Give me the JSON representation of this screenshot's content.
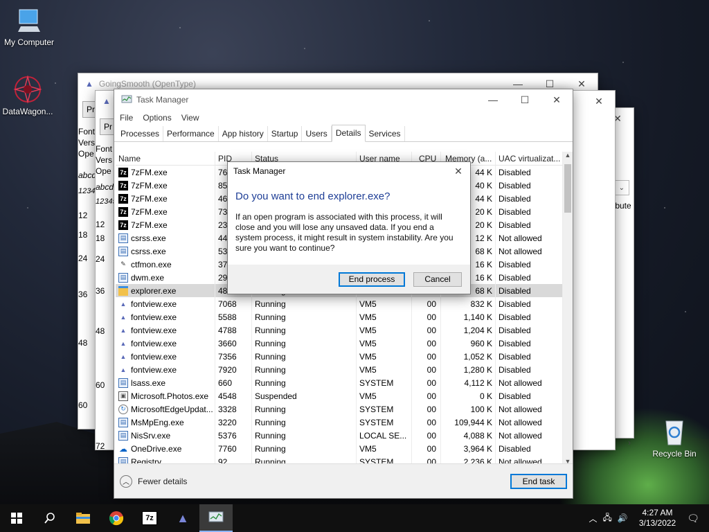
{
  "desktop": {
    "icons": [
      {
        "label": "My Computer"
      },
      {
        "label": "DataWagon..."
      },
      {
        "label": "Recycle Bin"
      }
    ]
  },
  "bg_window_1": {
    "title": "GoingSmooth (OpenType)",
    "left_labels": [
      "Pr",
      "Font",
      "Vers",
      "Ope",
      "abcd",
      "12345",
      "12",
      "18",
      "24",
      "36",
      "48",
      "60"
    ]
  },
  "bg_window_2": {
    "left_labels": [
      "Pr",
      "Font",
      "Vers",
      "Ope",
      "abcd",
      "12345",
      "12",
      "18",
      "24",
      "36",
      "48",
      "60",
      "72"
    ]
  },
  "bg_window_3": {
    "attribute_label": "Attribute"
  },
  "task_manager": {
    "title": "Task Manager",
    "menu": [
      "File",
      "Options",
      "View"
    ],
    "tabs": [
      "Processes",
      "Performance",
      "App history",
      "Startup",
      "Users",
      "Details",
      "Services"
    ],
    "active_tab": "Details",
    "columns": [
      "Name",
      "PID",
      "Status",
      "User name",
      "CPU",
      "Memory (a...",
      "UAC virtualizat..."
    ],
    "rows": [
      {
        "name": "7zFM.exe",
        "pid": "76",
        "status": "",
        "user": "",
        "cpu": "",
        "mem": "44 K",
        "uac": "Disabled",
        "icon": "7z"
      },
      {
        "name": "7zFM.exe",
        "pid": "85",
        "status": "",
        "user": "",
        "cpu": "",
        "mem": "40 K",
        "uac": "Disabled",
        "icon": "7z"
      },
      {
        "name": "7zFM.exe",
        "pid": "46",
        "status": "",
        "user": "",
        "cpu": "",
        "mem": "44 K",
        "uac": "Disabled",
        "icon": "7z"
      },
      {
        "name": "7zFM.exe",
        "pid": "73",
        "status": "",
        "user": "",
        "cpu": "",
        "mem": "20 K",
        "uac": "Disabled",
        "icon": "7z"
      },
      {
        "name": "7zFM.exe",
        "pid": "23",
        "status": "",
        "user": "",
        "cpu": "",
        "mem": "20 K",
        "uac": "Disabled",
        "icon": "7z"
      },
      {
        "name": "csrss.exe",
        "pid": "44",
        "status": "",
        "user": "",
        "cpu": "",
        "mem": "12 K",
        "uac": "Not allowed",
        "icon": "sys"
      },
      {
        "name": "csrss.exe",
        "pid": "53",
        "status": "",
        "user": "",
        "cpu": "",
        "mem": "68 K",
        "uac": "Not allowed",
        "icon": "sys"
      },
      {
        "name": "ctfmon.exe",
        "pid": "37",
        "status": "",
        "user": "",
        "cpu": "",
        "mem": "16 K",
        "uac": "Disabled",
        "icon": "pen"
      },
      {
        "name": "dwm.exe",
        "pid": "29",
        "status": "",
        "user": "",
        "cpu": "",
        "mem": "16 K",
        "uac": "Disabled",
        "icon": "sys"
      },
      {
        "name": "explorer.exe",
        "pid": "48",
        "status": "Running",
        "user": "",
        "cpu": "",
        "mem": "68 K",
        "uac": "Disabled",
        "icon": "folder",
        "selected": true
      },
      {
        "name": "fontview.exe",
        "pid": "7068",
        "status": "Running",
        "user": "VM5",
        "cpu": "00",
        "mem": "832 K",
        "uac": "Disabled",
        "icon": "font"
      },
      {
        "name": "fontview.exe",
        "pid": "5588",
        "status": "Running",
        "user": "VM5",
        "cpu": "00",
        "mem": "1,140 K",
        "uac": "Disabled",
        "icon": "font"
      },
      {
        "name": "fontview.exe",
        "pid": "4788",
        "status": "Running",
        "user": "VM5",
        "cpu": "00",
        "mem": "1,204 K",
        "uac": "Disabled",
        "icon": "font"
      },
      {
        "name": "fontview.exe",
        "pid": "3660",
        "status": "Running",
        "user": "VM5",
        "cpu": "00",
        "mem": "960 K",
        "uac": "Disabled",
        "icon": "font"
      },
      {
        "name": "fontview.exe",
        "pid": "7356",
        "status": "Running",
        "user": "VM5",
        "cpu": "00",
        "mem": "1,052 K",
        "uac": "Disabled",
        "icon": "font"
      },
      {
        "name": "fontview.exe",
        "pid": "7920",
        "status": "Running",
        "user": "VM5",
        "cpu": "00",
        "mem": "1,280 K",
        "uac": "Disabled",
        "icon": "font"
      },
      {
        "name": "lsass.exe",
        "pid": "660",
        "status": "Running",
        "user": "SYSTEM",
        "cpu": "00",
        "mem": "4,112 K",
        "uac": "Not allowed",
        "icon": "sys"
      },
      {
        "name": "Microsoft.Photos.exe",
        "pid": "4548",
        "status": "Suspended",
        "user": "VM5",
        "cpu": "00",
        "mem": "0 K",
        "uac": "Disabled",
        "icon": "photo"
      },
      {
        "name": "MicrosoftEdgeUpdat...",
        "pid": "3328",
        "status": "Running",
        "user": "SYSTEM",
        "cpu": "00",
        "mem": "100 K",
        "uac": "Not allowed",
        "icon": "update"
      },
      {
        "name": "MsMpEng.exe",
        "pid": "3220",
        "status": "Running",
        "user": "SYSTEM",
        "cpu": "00",
        "mem": "109,944 K",
        "uac": "Not allowed",
        "icon": "sys"
      },
      {
        "name": "NisSrv.exe",
        "pid": "5376",
        "status": "Running",
        "user": "LOCAL SE...",
        "cpu": "00",
        "mem": "4,088 K",
        "uac": "Not allowed",
        "icon": "sys"
      },
      {
        "name": "OneDrive.exe",
        "pid": "7760",
        "status": "Running",
        "user": "VM5",
        "cpu": "00",
        "mem": "3,964 K",
        "uac": "Disabled",
        "icon": "cloud"
      },
      {
        "name": "Registry",
        "pid": "92",
        "status": "Running",
        "user": "SYSTEM",
        "cpu": "00",
        "mem": "2,236 K",
        "uac": "Not allowed",
        "icon": "sys"
      }
    ],
    "fewer_details": "Fewer details",
    "end_task": "End task"
  },
  "dialog": {
    "title": "Task Manager",
    "heading": "Do you want to end explorer.exe?",
    "body": "If an open program is associated with this process, it will close and you will lose any unsaved data. If you end a system process, it might result in system instability. Are you sure you want to continue?",
    "end_process": "End process",
    "cancel": "Cancel"
  },
  "taskbar": {
    "time": "4:27 AM",
    "date": "3/13/2022"
  }
}
